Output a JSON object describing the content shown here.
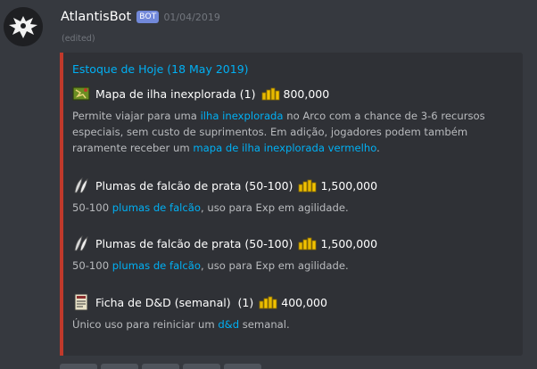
{
  "message": {
    "author": "AtlantisBot",
    "bot_tag": "BOT",
    "timestamp": "01/04/2019",
    "edited": "(edited)"
  },
  "embed": {
    "accent_color": "#c0392b",
    "title": "Estoque de Hoje (18 May 2019)",
    "items": [
      {
        "icon": "island-map-icon",
        "name": "Mapa de ilha inexplorada (1)",
        "price": "800,000",
        "desc": {
          "p1": "Permite viajar para uma ",
          "l1": "ilha inexplorada",
          "p2": " no Arco com a chance de 3-6 recursos especiais, sem custo de suprimentos. Em adição, jogadores podem também raramente receber um ",
          "l2": "mapa de ilha inexplorada vermelho",
          "p3": "."
        }
      },
      {
        "icon": "feather-icon",
        "name": "Plumas de falcão de prata (50-100)",
        "price": "1,500,000",
        "desc": {
          "p1": "50-100 ",
          "l1": "plumas de falcão",
          "p2": ", uso para Exp em agilidade."
        }
      },
      {
        "icon": "feather-icon",
        "name": "Plumas de falcão de prata (50-100)",
        "price": "1,500,000",
        "desc": {
          "p1": "50-100 ",
          "l1": "plumas de falcão",
          "p2": ", uso para Exp em agilidade."
        }
      },
      {
        "icon": "dnd-token-icon",
        "name": "Ficha de D&D (semanal)  (1)",
        "price": "400,000",
        "desc": {
          "p1": "Único uso para reiniciar um ",
          "l1": "d&d",
          "p2": " semanal."
        }
      }
    ]
  }
}
